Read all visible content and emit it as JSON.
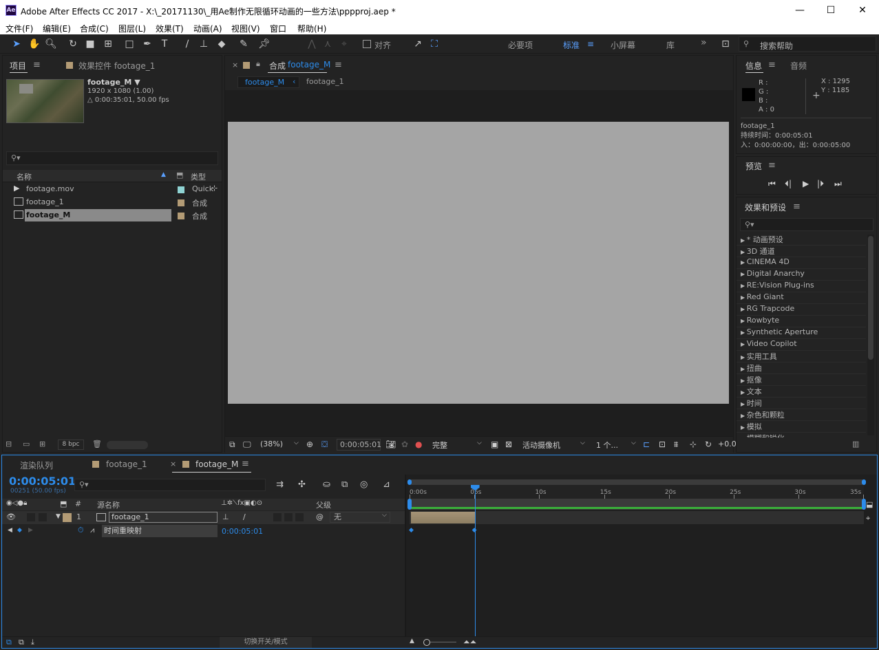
{
  "window": {
    "title": "Adobe After Effects CC 2017 - X:\\_20171130\\_用Ae制作无限循环动画的一些方法\\pppproj.aep *",
    "app_icon": "Ae",
    "minimize": "—",
    "maximize": "☐",
    "close": "✕"
  },
  "menu": [
    "文件(F)",
    "编辑(E)",
    "合成(C)",
    "图层(L)",
    "效果(T)",
    "动画(A)",
    "视图(V)",
    "窗口",
    "帮助(H)"
  ],
  "toolbar": {
    "snap_label": "对齐",
    "workspaces": [
      "必要项",
      "标准",
      "小屏幕",
      "库"
    ],
    "active_workspace": "标准",
    "more": "»",
    "search_placeholder": "搜索帮助"
  },
  "project_panel": {
    "tab": "项目",
    "tab2": "效果控件 footage_1",
    "footage_name": "footage_M ▼",
    "footage_res": "1920 x 1080 (1.00)",
    "footage_dur": "△ 0:00:35:01, 50.00 fps",
    "search_placeholder": "",
    "col_name": "名称",
    "col_type": "类型",
    "items": [
      {
        "name": "footage.mov",
        "type": "Quick",
        "color": "#8fd3d3"
      },
      {
        "name": "footage_1",
        "type": "合成",
        "color": "#b39b75"
      },
      {
        "name": "footage_M",
        "type": "合成",
        "color": "#b39b75"
      }
    ],
    "bpc": "8 bpc"
  },
  "comp_panel": {
    "close": "×",
    "tab_label": "合成",
    "tab_name": "footage_M",
    "crumb1": "footage_M",
    "crumb2": "footage_1",
    "canvas_color": "#a5a5a5",
    "zoom": "(38%)",
    "timecode": "0:00:05:01",
    "quality": "完整",
    "camera": "活动摄像机",
    "views": "1 个...",
    "exposure": "+0.0"
  },
  "info_panel": {
    "tab": "信息",
    "tab2": "音频",
    "r": "R :",
    "g": "G :",
    "b": "B :",
    "a": "A : 0",
    "x": "X : 1295",
    "y": "Y : 1185",
    "layer_name": "footage_1",
    "duration": "持续时间：0:00:05:01",
    "inout": "入：0:00:00:00，出：0:00:05:00"
  },
  "preview_panel": {
    "tab": "预览"
  },
  "effects_panel": {
    "tab": "效果和预设",
    "items": [
      "* 动画预设",
      "3D 通道",
      "CINEMA 4D",
      "Digital Anarchy",
      "RE:Vision Plug-ins",
      "Red Giant",
      "RG Trapcode",
      "Rowbyte",
      "Synthetic Aperture",
      "Video Copilot",
      "实用工具",
      "扭曲",
      "抠像",
      "文本",
      "时间",
      "杂色和颗粒",
      "模拟",
      "模糊和锐化"
    ]
  },
  "timeline": {
    "tabs": [
      "渲染队列",
      "footage_1",
      "footage_M"
    ],
    "timecode": "0:00:05:01",
    "frame_info": "00251 (50.00 fps)",
    "col_source": "源名称",
    "col_parent": "父级",
    "col_num": "#",
    "layer_num": "1",
    "layer_name": "footage_1",
    "parent_value": "无",
    "property": "时间重映射",
    "property_value": "0:00:05:01",
    "ruler": [
      "0:00s",
      "05s",
      "10s",
      "15s",
      "20s",
      "25s",
      "30s",
      "35s"
    ],
    "toggle_label": "切换开关/模式",
    "playhead_seconds": 5.02,
    "comp_duration_seconds": 35.02,
    "layer_bar_color": "#a59477",
    "work_area_color": "#3ab03a"
  }
}
